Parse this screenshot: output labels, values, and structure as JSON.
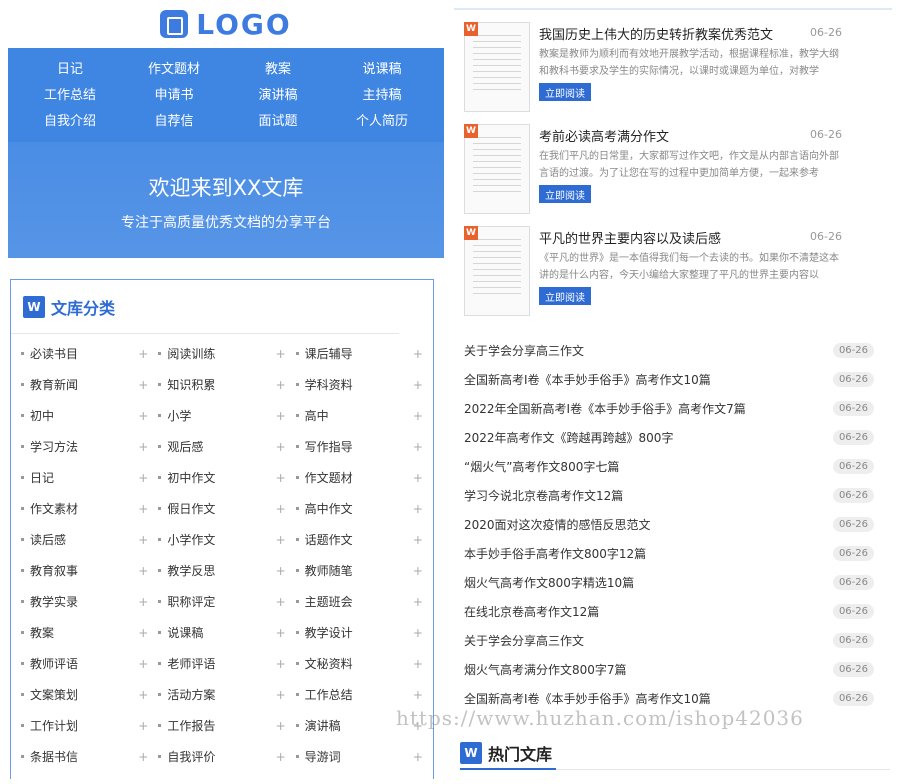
{
  "logo": {
    "text": "LOGO"
  },
  "nav": [
    "日记",
    "作文题材",
    "教案",
    "说课稿",
    "工作总结",
    "申请书",
    "演讲稿",
    "主持稿",
    "自我介绍",
    "自荐信",
    "面试题",
    "个人简历"
  ],
  "banner": {
    "welcome": "欢迎来到XX文库",
    "tagline": "专注于高质量优秀文档的分享平台"
  },
  "categories": {
    "title": "文库分类",
    "items": [
      "必读书目",
      "阅读训练",
      "课后辅导",
      "教育新闻",
      "知识积累",
      "学科资料",
      "初中",
      "小学",
      "高中",
      "学习方法",
      "观后感",
      "写作指导",
      "日记",
      "初中作文",
      "作文题材",
      "作文素材",
      "假日作文",
      "高中作文",
      "读后感",
      "小学作文",
      "话题作文",
      "教育叙事",
      "教学反思",
      "教师随笔",
      "教学实录",
      "职称评定",
      "主题班会",
      "教案",
      "说课稿",
      "教学设计",
      "教师评语",
      "老师评语",
      "文秘资料",
      "文案策划",
      "活动方案",
      "工作总结",
      "工作计划",
      "工作报告",
      "演讲稿",
      "条据书信",
      "自我评价",
      "导游词"
    ],
    "plus": "+"
  },
  "articles": [
    {
      "title": "我国历史上伟大的历史转折教案优秀范文",
      "date": "06-26",
      "desc": "教案是教师为顺利而有效地开展教学活动，根据课程标准，教学大纲和教科书要求及学生的实际情况，以课时或课题为单位，对教学",
      "btn": "立即阅读"
    },
    {
      "title": "考前必读高考满分作文",
      "date": "06-26",
      "desc": "在我们平凡的日常里，大家都写过作文吧，作文是从内部言语向外部言语的过渡。为了让您在写的过程中更加简单方便，一起来参考",
      "btn": "立即阅读"
    },
    {
      "title": "平凡的世界主要内容以及读后感",
      "date": "06-26",
      "desc": "《平凡的世界》是一本值得我们每一个去读的书。如果你不清楚这本讲的是什么内容，今天小编给大家整理了平凡的世界主要内容以",
      "btn": "立即阅读"
    }
  ],
  "badge": "W",
  "list": [
    {
      "title": "关于学会分享高三作文",
      "date": "06-26"
    },
    {
      "title": "全国新高考I卷《本手妙手俗手》高考作文10篇",
      "date": "06-26"
    },
    {
      "title": "2022年全国新高考I卷《本手妙手俗手》高考作文7篇",
      "date": "06-26"
    },
    {
      "title": "2022年高考作文《跨越再跨越》800字",
      "date": "06-26"
    },
    {
      "title": "“烟火气”高考作文800字七篇",
      "date": "06-26"
    },
    {
      "title": "学习今说北京卷高考作文12篇",
      "date": "06-26"
    },
    {
      "title": "2020面对这次疫情的感悟反思范文",
      "date": "06-26"
    },
    {
      "title": "本手妙手俗手高考作文800字12篇",
      "date": "06-26"
    },
    {
      "title": "烟火气高考作文800字精选10篇",
      "date": "06-26"
    },
    {
      "title": "在线北京卷高考作文12篇",
      "date": "06-26"
    },
    {
      "title": "关于学会分享高三作文",
      "date": "06-26"
    },
    {
      "title": "烟火气高考满分作文800字7篇",
      "date": "06-26"
    },
    {
      "title": "全国新高考I卷《本手妙手俗手》高考作文10篇",
      "date": "06-26"
    }
  ],
  "hot": {
    "title": "热门文库"
  },
  "watermark": "https://www.huzhan.com/ishop42036"
}
